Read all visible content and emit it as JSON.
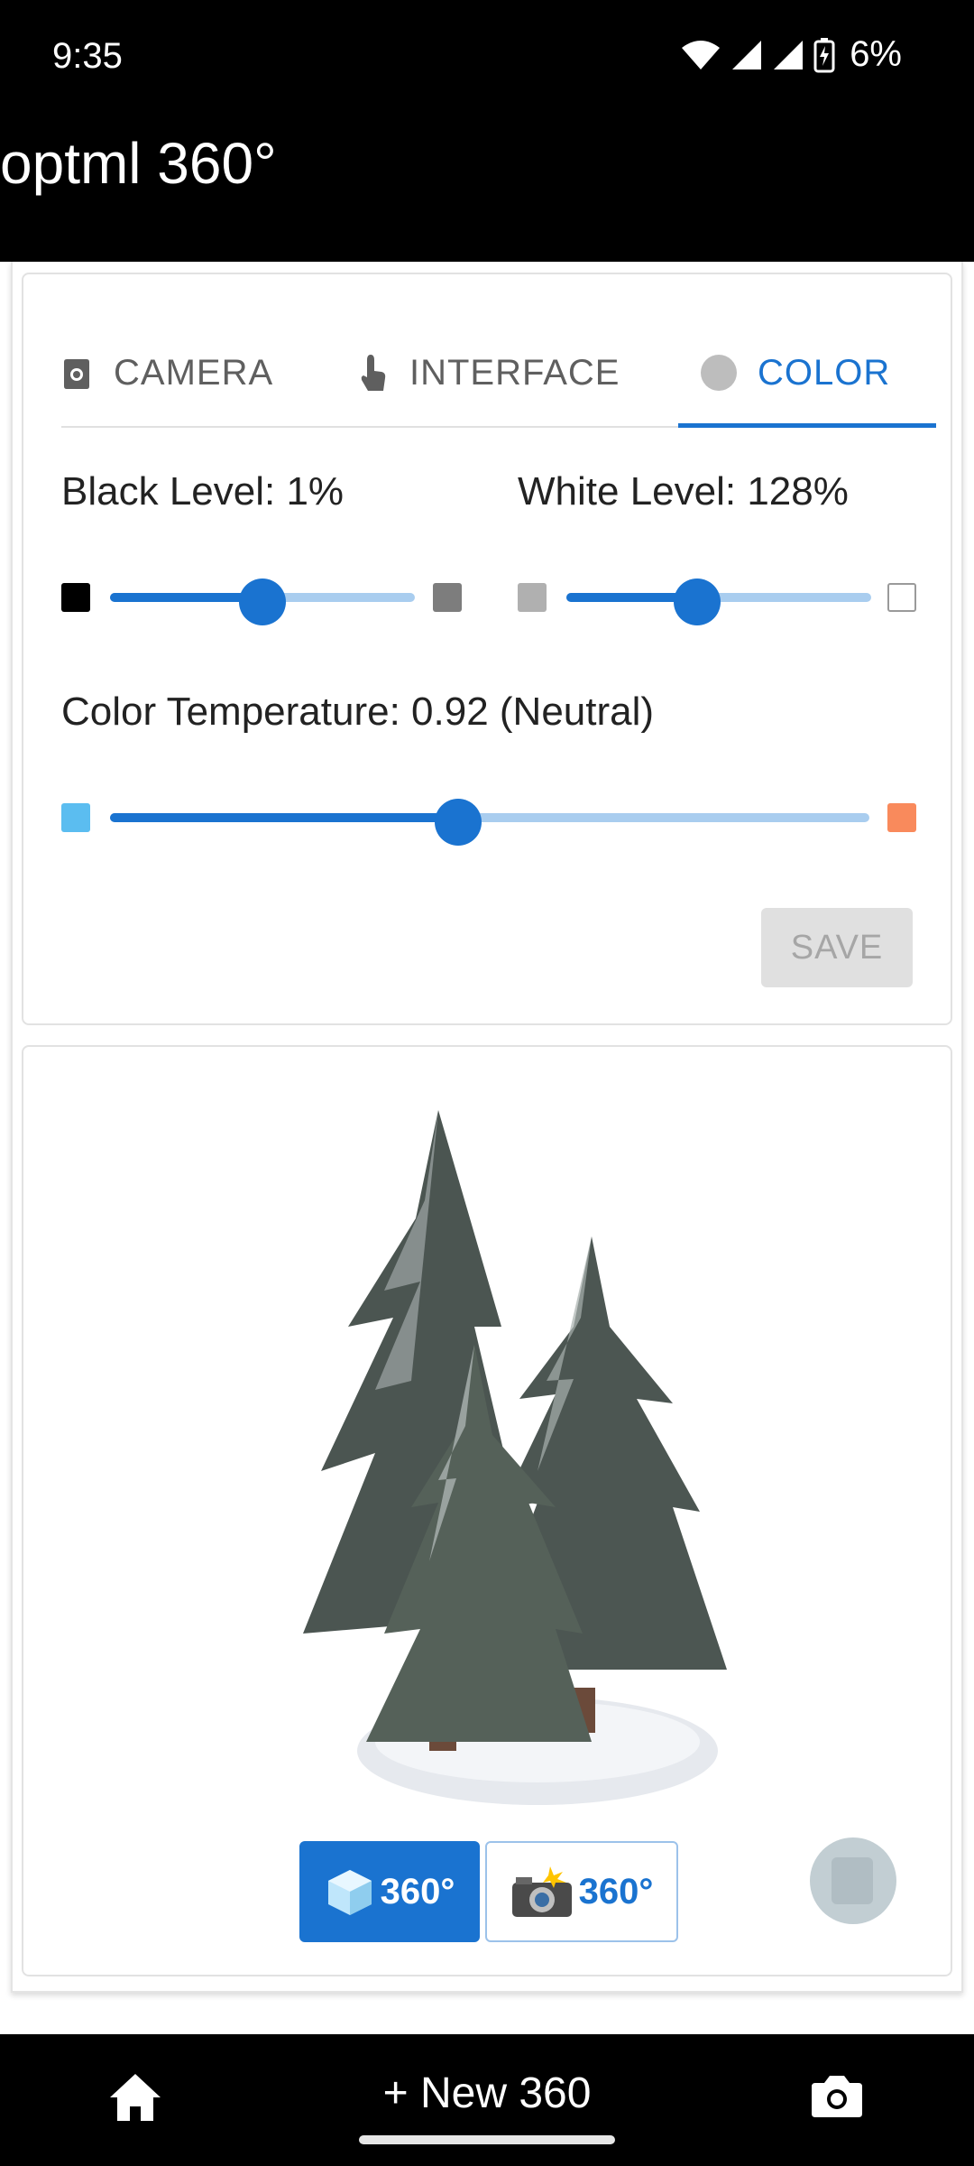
{
  "status_bar": {
    "time": "9:35",
    "battery": "6%",
    "icons": [
      "wifi-icon",
      "signal-icon",
      "signal-icon",
      "battery-charging-icon"
    ]
  },
  "app_bar": {
    "title": "optml 360°"
  },
  "tabs": [
    {
      "label": "CAMERA",
      "icon": "camera-icon",
      "active": false
    },
    {
      "label": "INTERFACE",
      "icon": "touch-icon",
      "active": false
    },
    {
      "label": "COLOR",
      "icon": "circle-icon",
      "active": true
    }
  ],
  "color_settings": {
    "black_level": {
      "label": "Black Level: 1%",
      "position": 0.5
    },
    "white_level": {
      "label": "White Level: 128%",
      "position": 0.43
    },
    "color_temperature": {
      "label": "Color Temperature: 0.92 (Neutral)",
      "position": 0.46
    },
    "save_label": "SAVE"
  },
  "viewer": {
    "mode_buttons": [
      {
        "label": "360°",
        "icon": "ice-cube-icon",
        "active": true
      },
      {
        "label": "360°",
        "icon": "camera-flash-icon",
        "active": false
      }
    ]
  },
  "bottom_nav": {
    "home_icon": "home-icon",
    "new_label": "+ New 360",
    "camera_icon": "camera-icon"
  },
  "colors": {
    "accent": "#1a73d0",
    "track_inactive": "#a9cdef",
    "black_swatch": "#000000",
    "gray_swatch": "#7d7d7d",
    "light_gray_swatch": "#b0b0b0",
    "white_swatch": "#ffffff",
    "cool_swatch": "#5bbdf0",
    "warm_swatch": "#f98a5c"
  }
}
